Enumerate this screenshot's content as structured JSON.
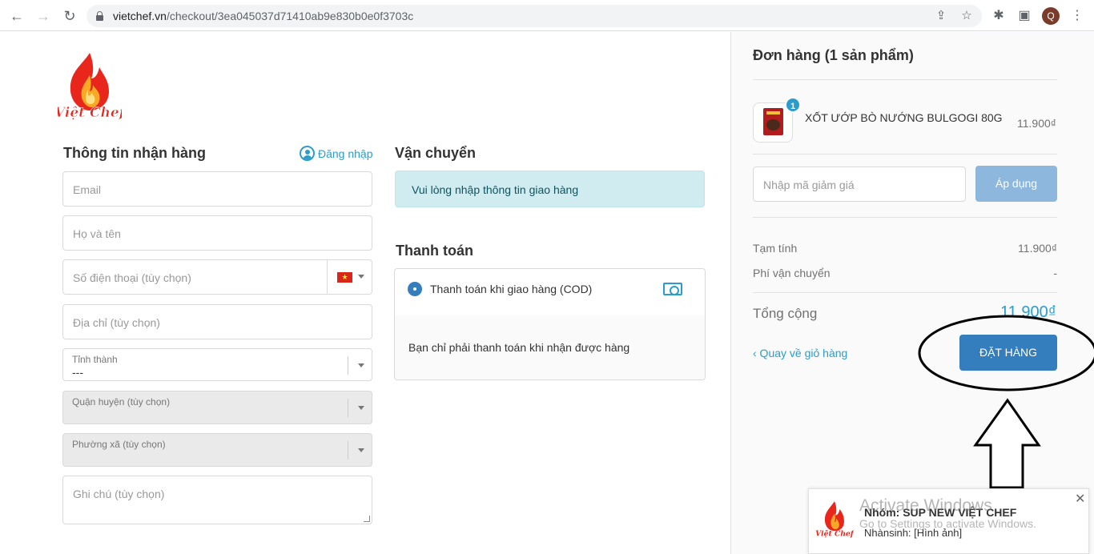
{
  "browser": {
    "url_domain": "vietchef.vn",
    "url_path": "/checkout/3ea045037d71410ab9e830b0e0f3703c",
    "profile_initial": "Q"
  },
  "brand": {
    "logo_text": "Việt Chef"
  },
  "customer": {
    "title": "Thông tin nhận hàng",
    "login_label": "Đăng nhập",
    "email_placeholder": "Email",
    "name_placeholder": "Họ và tên",
    "phone_placeholder": "Số điện thoại (tùy chọn)",
    "phone_flag": "★",
    "address_placeholder": "Địa chỉ (tùy chọn)",
    "province_label": "Tỉnh thành",
    "province_value": "---",
    "district_label": "Quận huyện (tùy chọn)",
    "ward_label": "Phường xã (tùy chọn)",
    "note_placeholder": "Ghi chú (tùy chọn)"
  },
  "shipping": {
    "title": "Vận chuyển",
    "notice": "Vui lòng nhập thông tin giao hàng"
  },
  "payment": {
    "title": "Thanh toán",
    "method": "Thanh toán khi giao hàng (COD)",
    "description": "Bạn chỉ phải thanh toán khi nhận được hàng"
  },
  "order": {
    "title": "Đơn hàng (1 sản phẩm)",
    "items": [
      {
        "quantity": "1",
        "name": "XỐT ƯỚP BÒ NƯỚNG BULGOGI 80G",
        "price": "11.900₫"
      }
    ],
    "coupon_placeholder": "Nhập mã giảm giá",
    "apply_label": "Áp dụng",
    "subtotal_label": "Tạm tính",
    "subtotal_value": "11.900₫",
    "shipping_label": "Phí vận chuyển",
    "shipping_value": "-",
    "total_label": "Tổng cộng",
    "total_value": "11.900₫",
    "back_label": "‹ Quay về giỏ hàng",
    "place_order_label": "ĐẶT HÀNG"
  },
  "notification": {
    "title": "Nhóm: SUP NEW VIỆT CHEF",
    "subtitle": "Nhànsinh: [Hình ảnh]",
    "close": "✕"
  },
  "watermark": {
    "line1": "Activate Windows",
    "line2": "Go to Settings to activate Windows."
  },
  "colors": {
    "accent": "#2a9dcc",
    "primary_button": "#357ebd",
    "apply_button": "#8db7dd",
    "notice_bg": "#d1ecf1"
  }
}
